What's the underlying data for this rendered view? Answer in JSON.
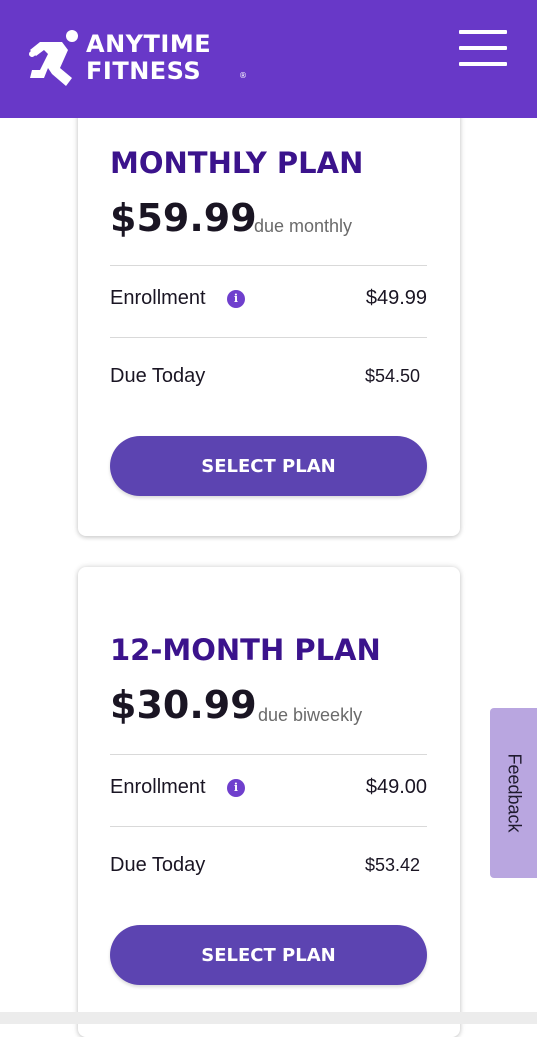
{
  "header": {
    "brand_line1": "ANYTIME",
    "brand_line2": "FITNESS",
    "brand_mark": "®",
    "background": "#6838c8",
    "menu_icon": "hamburger-menu-icon",
    "logo_icon": "running-man-icon"
  },
  "plans": [
    {
      "name": "MONTHLY PLAN",
      "price": "$59.99",
      "period": "due monthly",
      "enrollment_label": "Enrollment",
      "enrollment_value": "$49.99",
      "due_today_label": "Due Today",
      "due_today_value": "$54.50",
      "button_label": "SELECT PLAN"
    },
    {
      "name": "12-MONTH PLAN",
      "price": "$30.99",
      "period": "due biweekly",
      "enrollment_label": "Enrollment",
      "enrollment_value": "$49.00",
      "due_today_label": "Due Today",
      "due_today_value": "$53.42",
      "button_label": "SELECT PLAN"
    }
  ],
  "info_icon_glyph": "i",
  "feedback": {
    "label": "Feedback"
  },
  "colors": {
    "accent": "#6838c8",
    "plan_title": "#3b138c",
    "button": "#5c44b1",
    "feedback_tab": "#b9a6e0"
  }
}
